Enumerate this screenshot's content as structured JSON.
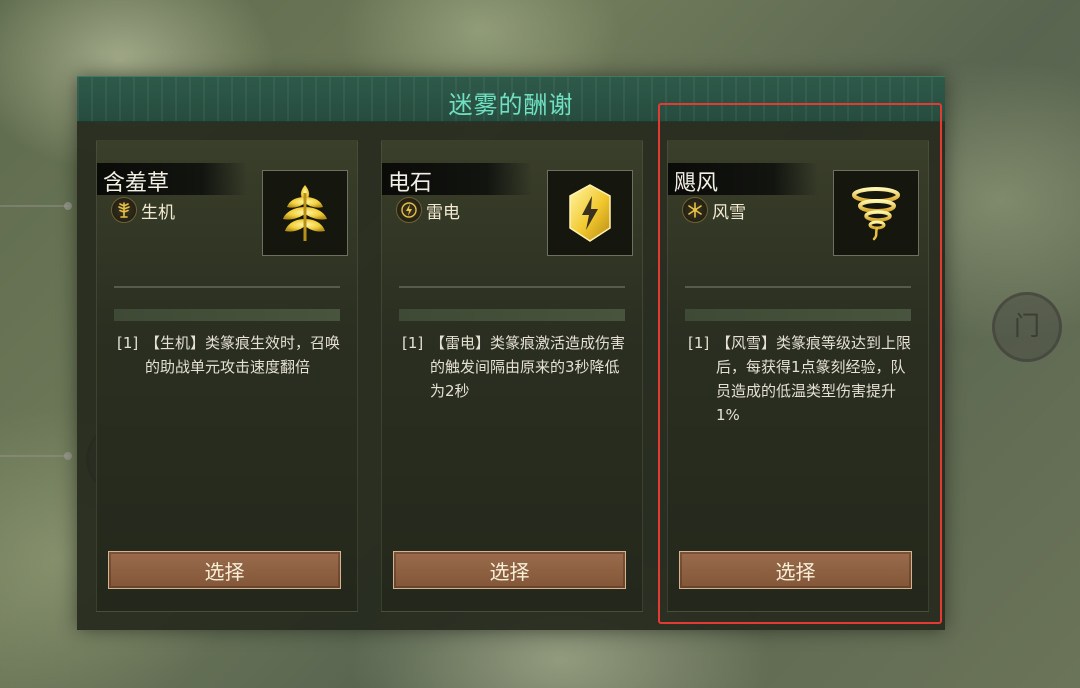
{
  "dialog": {
    "title": "迷雾的酬谢"
  },
  "cards": [
    {
      "name": "含羞草",
      "element": "生机",
      "element_icon": "leaf-tree-icon",
      "item_icon": "golden-leaf-icon",
      "level": "[1]",
      "description": "【生机】类篆痕生效时，召唤的助战单元攻击速度翻倍",
      "button": "选择"
    },
    {
      "name": "电石",
      "element": "雷电",
      "element_icon": "lightning-icon",
      "item_icon": "lightning-crystal-icon",
      "level": "[1]",
      "description": "【雷电】类篆痕激活造成伤害的触发间隔由原来的3秒降低为2秒",
      "button": "选择"
    },
    {
      "name": "飓风",
      "element": "风雪",
      "element_icon": "snowflake-icon",
      "item_icon": "tornado-icon",
      "level": "[1]",
      "description": "【风雪】类篆痕等级达到上限后，每获得1点篆刻经验，队员造成的低温类型伤害提升1%",
      "button": "选择"
    }
  ],
  "colors": {
    "title": "#6fe0c2",
    "header_bg": "#2e5a4a",
    "button_bg": "#9a6c4d",
    "highlight": "#e33a32",
    "element_gold": "#e8c046"
  }
}
